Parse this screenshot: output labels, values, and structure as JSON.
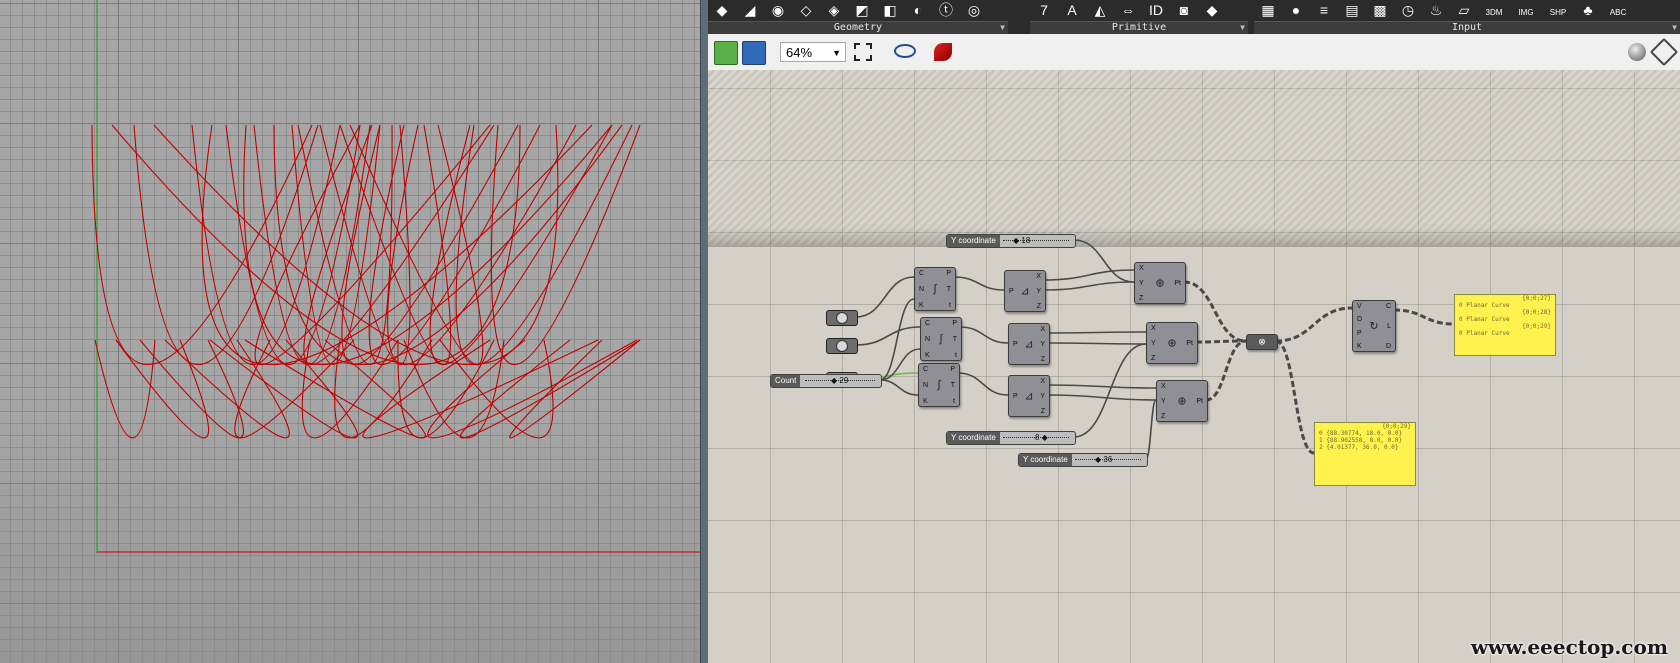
{
  "ribbon": {
    "groups": [
      {
        "label": "Geometry",
        "icons": [
          "◆",
          "◢",
          "◉",
          "◇",
          "◈",
          "◩",
          "◧",
          "◐",
          "ⓣ",
          "◎"
        ]
      },
      {
        "label": "Primitive",
        "icons": [
          "7",
          "A",
          "◭",
          "⇔",
          "ID",
          "◙",
          "◆"
        ]
      },
      {
        "label": "Input",
        "icons": [
          "▦",
          "●",
          "≡",
          "▤",
          "▩",
          "◷",
          "♨",
          "▱",
          "3DM",
          "IMG",
          "SHP",
          "♣",
          "ABC"
        ]
      }
    ]
  },
  "toolbar": {
    "zoom_value": "64%",
    "icons": [
      "open-file-icon",
      "save-file-icon",
      "zoom-extents-icon",
      "preview-eye-icon",
      "sketch-pen-icon",
      "shaded-preview-icon",
      "wire-display-icon"
    ]
  },
  "sliders": [
    {
      "name": "Y coordinate",
      "value": "18"
    },
    {
      "name": "Count",
      "value": "29"
    },
    {
      "name": "Y coordinate",
      "value": "8"
    },
    {
      "name": "Y coordinate",
      "value": "36"
    }
  ],
  "nodes": {
    "divide_inputs": [
      "C",
      "N",
      "K"
    ],
    "divide_outputs": [
      "P",
      "T",
      "t"
    ],
    "decompose_input": "P",
    "decompose_outputs": [
      "X",
      "Y",
      "Z"
    ],
    "construct_inputs": [
      "X",
      "Y",
      "Z"
    ],
    "construct_output": "Pt",
    "interp_inputs": [
      "V",
      "D",
      "P",
      "K"
    ],
    "interp_outputs": [
      "C",
      "L",
      "D"
    ]
  },
  "panels": {
    "curves": {
      "rows": [
        {
          "path": "{0;0;27}",
          "index": "0",
          "text": "Planar Curve"
        },
        {
          "path": "{0;0;28}",
          "index": "0",
          "text": "Planar Curve"
        },
        {
          "path": "{0;0;29}",
          "index": "0",
          "text": "Planar Curve"
        }
      ]
    },
    "points": {
      "path": "{0;0;29}",
      "rows": [
        {
          "index": "0",
          "text": "{88.30774, 18.0, 0.0}"
        },
        {
          "index": "1",
          "text": "{88.902558, 8.0, 0.0}"
        },
        {
          "index": "2",
          "text": "{4.01377, 36.0, 0.0}"
        }
      ]
    }
  },
  "watermark": "www.eeectop.com",
  "colors": {
    "curve": "#c00000",
    "panel": "#fff24f",
    "toggle_on": "#42c23a"
  }
}
